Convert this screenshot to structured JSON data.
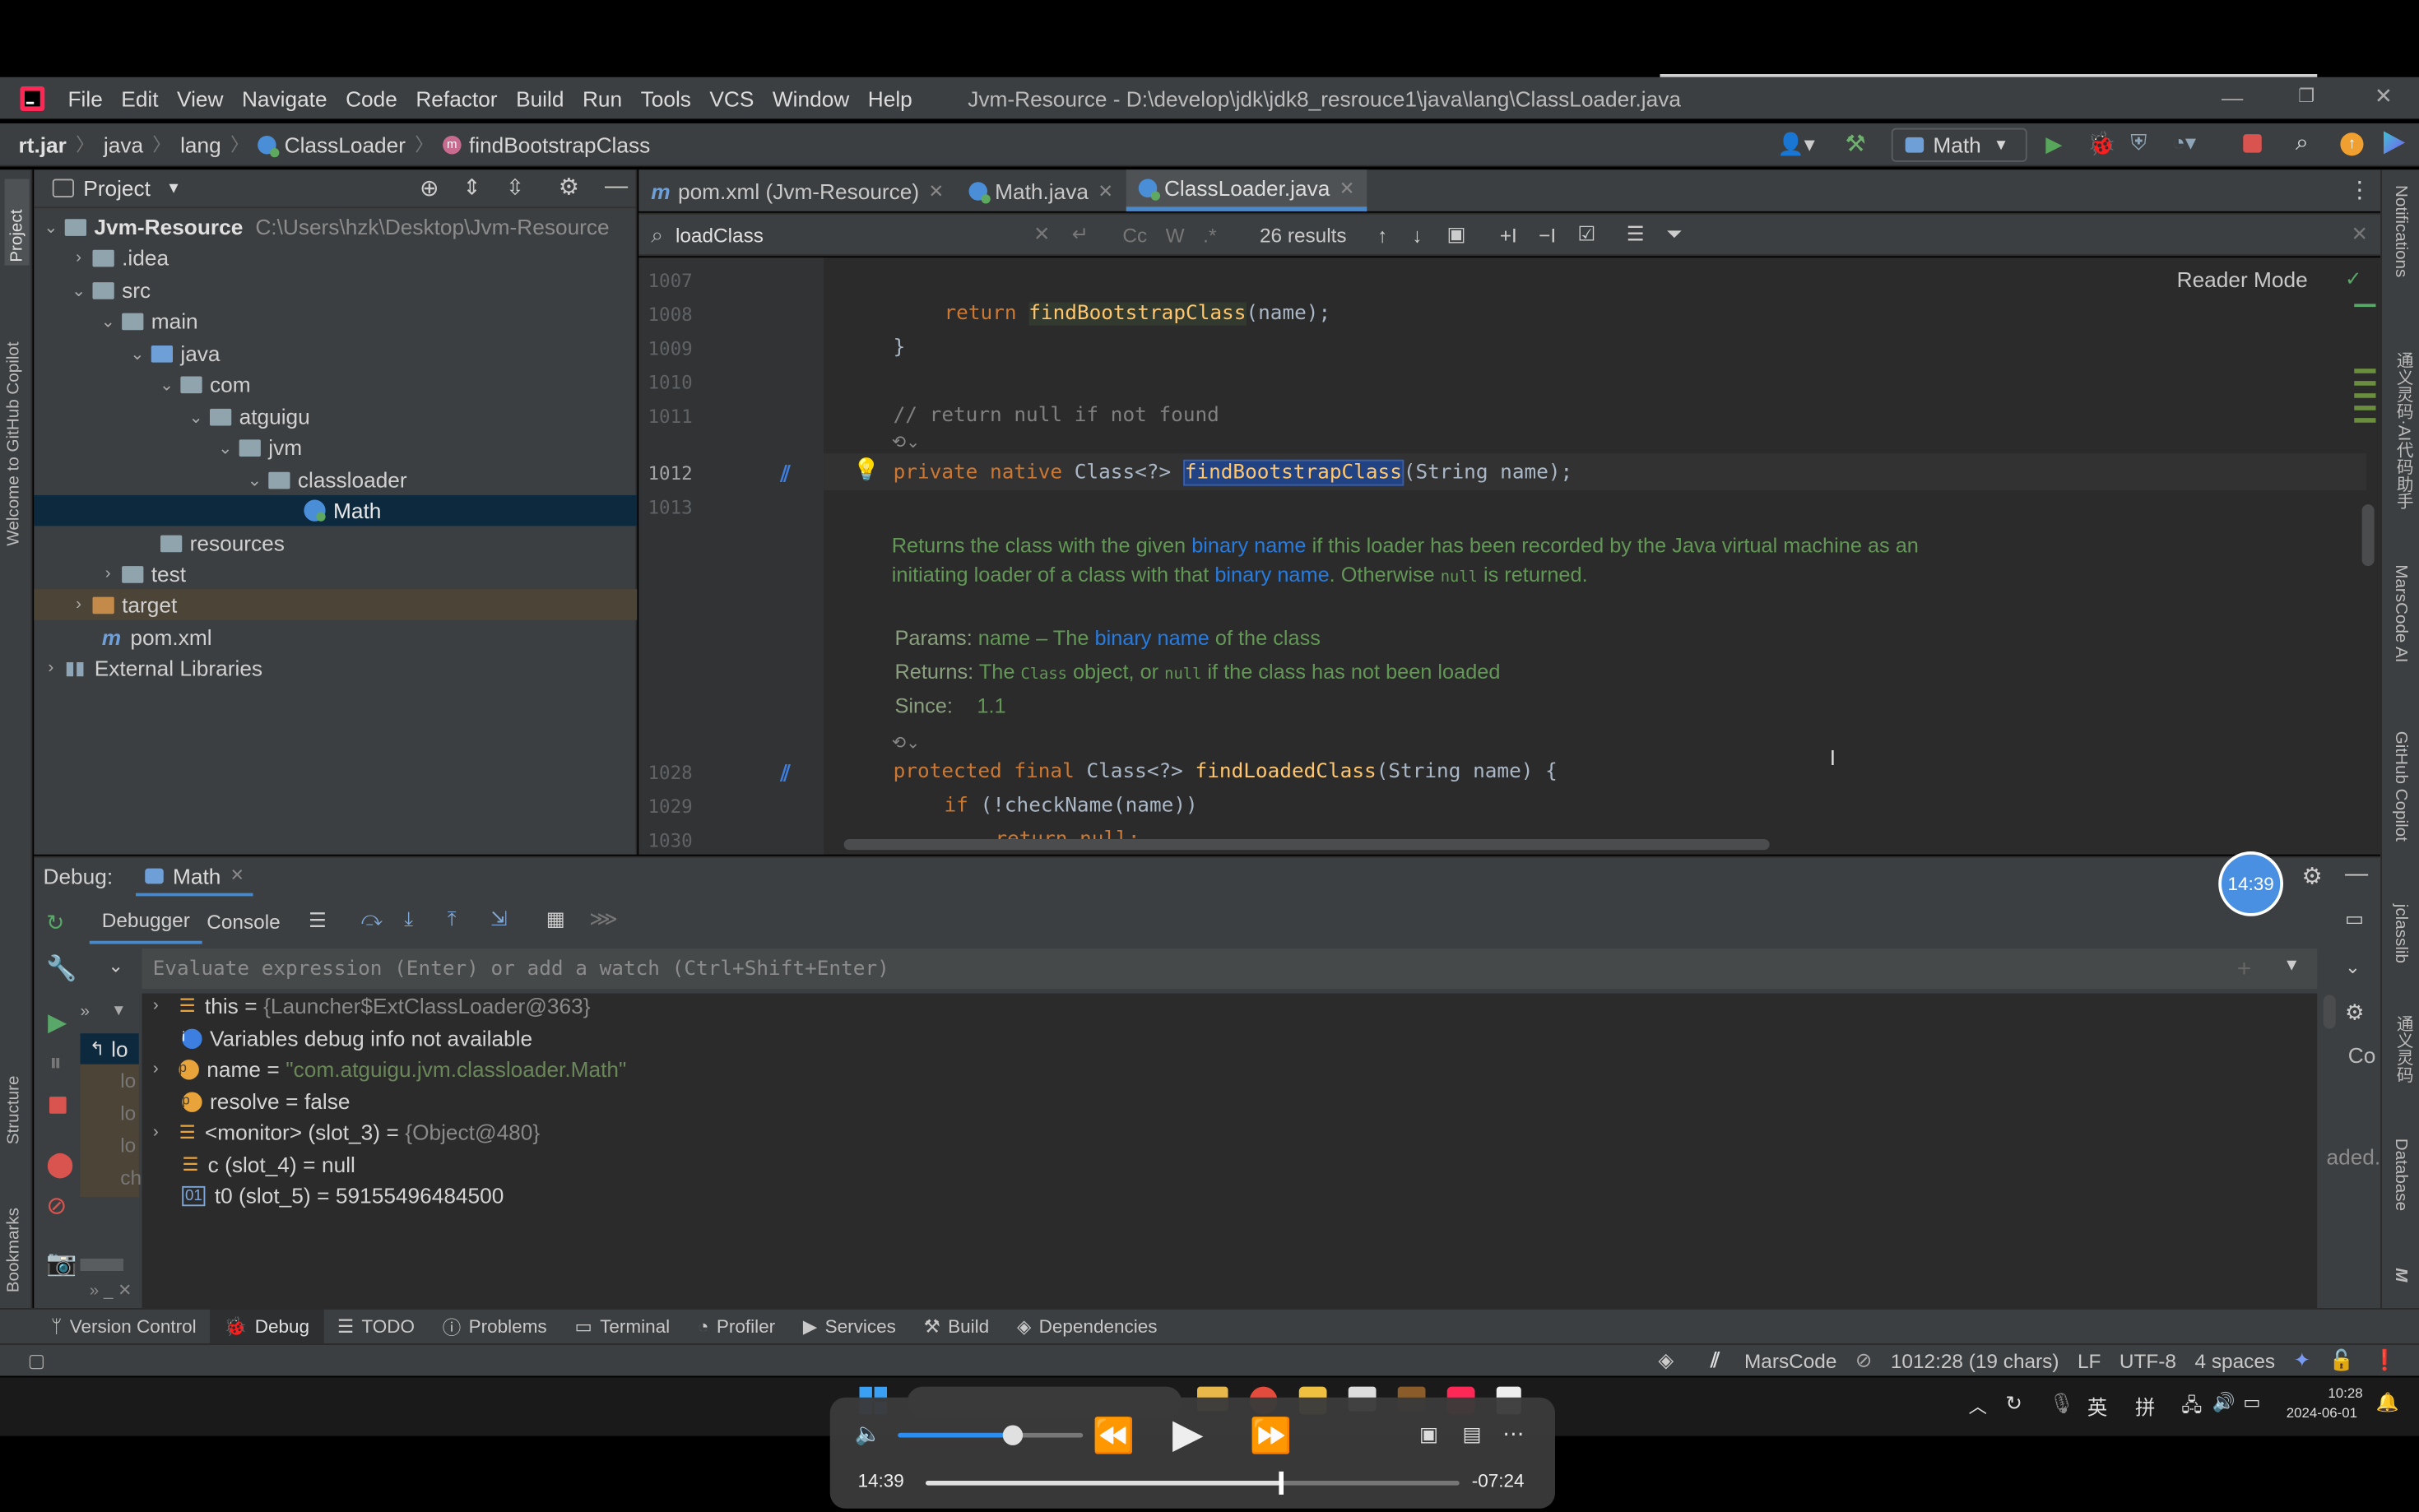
{
  "menu": [
    "File",
    "Edit",
    "View",
    "Navigate",
    "Code",
    "Refactor",
    "Build",
    "Run",
    "Tools",
    "VCS",
    "Window",
    "Help"
  ],
  "window_title": "Jvm-Resource - D:\\develop\\jdk\\jdk8_resrouce1\\java\\lang\\ClassLoader.java",
  "breadcrumbs": [
    "rt.jar",
    "java",
    "lang",
    "ClassLoader",
    "findBootstrapClass"
  ],
  "run_config": "Math",
  "left_strip": {
    "project": "Project",
    "copilot": "Welcome to GitHub Copilot",
    "structure": "Structure",
    "bookmarks": "Bookmarks"
  },
  "right_strip": {
    "notifications": "Notifications",
    "ai": "通义灵码·AI代码助手",
    "marscode": "MarsCode AI",
    "github_copilot": "GitHub Copilot",
    "jclasslib": "jclasslib",
    "tongyi": "通义灵码",
    "database": "Database",
    "maven": "M"
  },
  "project": {
    "title": "Project",
    "root_name": "Jvm-Resource",
    "root_path": "C:\\Users\\hzk\\Desktop\\Jvm-Resource",
    "items": [
      ".idea",
      "src",
      "main",
      "java",
      "com",
      "atguigu",
      "jvm",
      "classloader",
      "Math",
      "resources",
      "test",
      "target",
      "pom.xml",
      "External Libraries"
    ]
  },
  "tabs": [
    "pom.xml (Jvm-Resource)",
    "Math.java",
    "ClassLoader.java"
  ],
  "find": {
    "query": "loadClass",
    "cc": "Cc",
    "w": "W",
    "regex": ".*",
    "results": "26 results"
  },
  "editor": {
    "reader_mode": "Reader Mode",
    "lines": {
      "l1007": "1007",
      "l1008": "1008",
      "l1009": "1009",
      "l1010": "1010",
      "l1011": "1011",
      "l1012": "1012",
      "l1013": "1013",
      "l1028": "1028",
      "l1029": "1029",
      "l1030": "1030"
    },
    "code": {
      "ret_kw": "return",
      "ret_fn": "findBootstrapClass",
      "ret_args": "(name);",
      "brace": "}",
      "comment": "// return null if not found",
      "priv_kw": "private native",
      "priv_type": "Class<?>",
      "priv_fn": "findBootstrapClass",
      "priv_args": "(String name);",
      "prot_kw": "protected final",
      "prot_type": "Class<?>",
      "prot_fn": "findLoadedClass",
      "prot_args": "(String name) {",
      "if_kw": "if",
      "if_rest": "(!checkName(name))",
      "ret2_kw": "return",
      "ret2_val": "null;"
    },
    "doc": {
      "p1": "Returns the class with the given",
      "link1": "binary name",
      "p2": "if this loader has been recorded by the Java virtual machine as an initiating loader of a class with that",
      "link2": "binary name",
      "p3": ". Otherwise",
      "null1": "null",
      "p4": "is returned.",
      "params_label": "Params:",
      "params_text1": "name – The",
      "params_link": "binary name",
      "params_text2": "of the class",
      "returns_label": "Returns:",
      "returns_text1": "The",
      "returns_code1": "Class",
      "returns_text2": "object, or",
      "returns_code2": "null",
      "returns_text3": "if the class has not been loaded",
      "since_label": "Since:",
      "since_val": "1.1"
    }
  },
  "debug": {
    "label": "Debug:",
    "session": "Math",
    "tabs": [
      "Debugger",
      "Console"
    ],
    "timer": "14:39",
    "eval_placeholder": "Evaluate expression (Enter) or add a watch (Ctrl+Shift+Enter)",
    "frame_current": "lo",
    "frames": [
      "lo",
      "lo",
      "lo",
      "ch"
    ],
    "right_cut1": "Co",
    "right_cut2": "aded.",
    "vars": [
      {
        "name": "this",
        "eq": "=",
        "value": "{Launcher$ExtClassLoader@363}"
      },
      {
        "name": "Variables debug info not available",
        "eq": "",
        "value": ""
      },
      {
        "name": "name",
        "eq": "=",
        "value": "\"com.atguigu.jvm.classloader.Math\""
      },
      {
        "name": "resolve",
        "eq": "=",
        "value": "false"
      },
      {
        "name": "<monitor> (slot_3)",
        "eq": "=",
        "value": "{Object@480}"
      },
      {
        "name": "c (slot_4)",
        "eq": "=",
        "value": "null"
      },
      {
        "name": "t0 (slot_5)",
        "eq": "=",
        "value": "59155496484500"
      }
    ]
  },
  "toolwindows": [
    "Version Control",
    "Debug",
    "TODO",
    "Problems",
    "Terminal",
    "Profiler",
    "Services",
    "Build",
    "Dependencies"
  ],
  "status": {
    "marscode": "MarsCode",
    "position": "1012:28 (19 chars)",
    "line_sep": "LF",
    "encoding": "UTF-8",
    "indent": "4 spaces"
  },
  "taskbar": {
    "lang1": "英",
    "lang2": "拼",
    "time": "10:28",
    "date": "2024-06-01"
  },
  "video": {
    "current": "14:39",
    "remaining": "-07:24",
    "progress": 0.665,
    "volume": 0.62
  },
  "colors": {
    "accent": "#4a88c7",
    "keyword": "#cc7832",
    "function": "#ffc66d",
    "doc": "#629755",
    "link": "#287bde"
  }
}
